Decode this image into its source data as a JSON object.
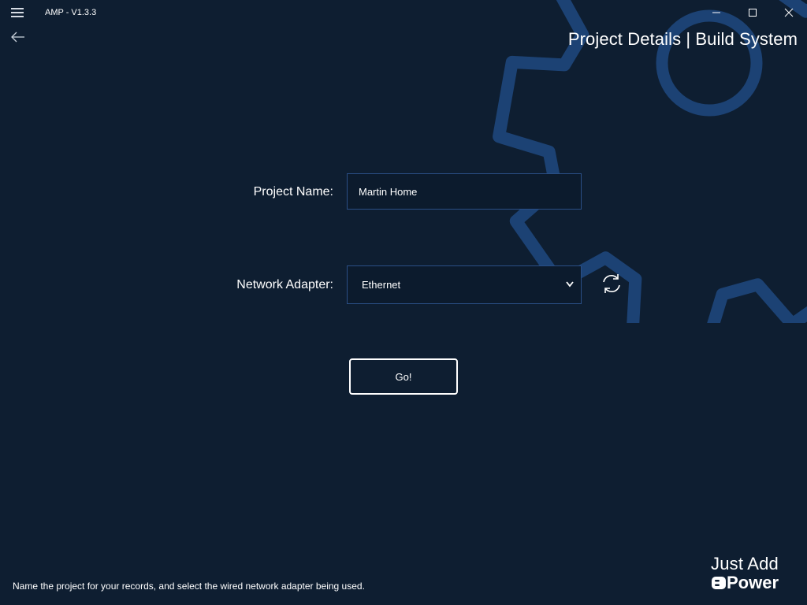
{
  "window": {
    "app_title": "AMP - V1.3.3",
    "page_title": "Project Details | Build System"
  },
  "form": {
    "project_name_label": "Project Name:",
    "project_name_value": "Martin Home",
    "network_adapter_label": "Network Adapter:",
    "network_adapter_value": "Ethernet",
    "go_label": "Go!"
  },
  "footer": {
    "hint": "Name the project for your records, and select the wired network adapter being used."
  },
  "brand": {
    "line1": "Just Add",
    "line2": "Power"
  },
  "icons": {
    "menu": "hamburger-menu-icon",
    "back": "back-arrow-icon",
    "minimize": "minimize-icon",
    "maximize": "maximize-icon",
    "close": "close-icon",
    "dropdown": "chevron-down-icon",
    "refresh": "refresh-icon",
    "background": "gear-icon"
  },
  "colors": {
    "background": "#0e1e31",
    "accent_border": "#2a4f86",
    "gear": "#1c4274",
    "text": "#ffffff"
  }
}
